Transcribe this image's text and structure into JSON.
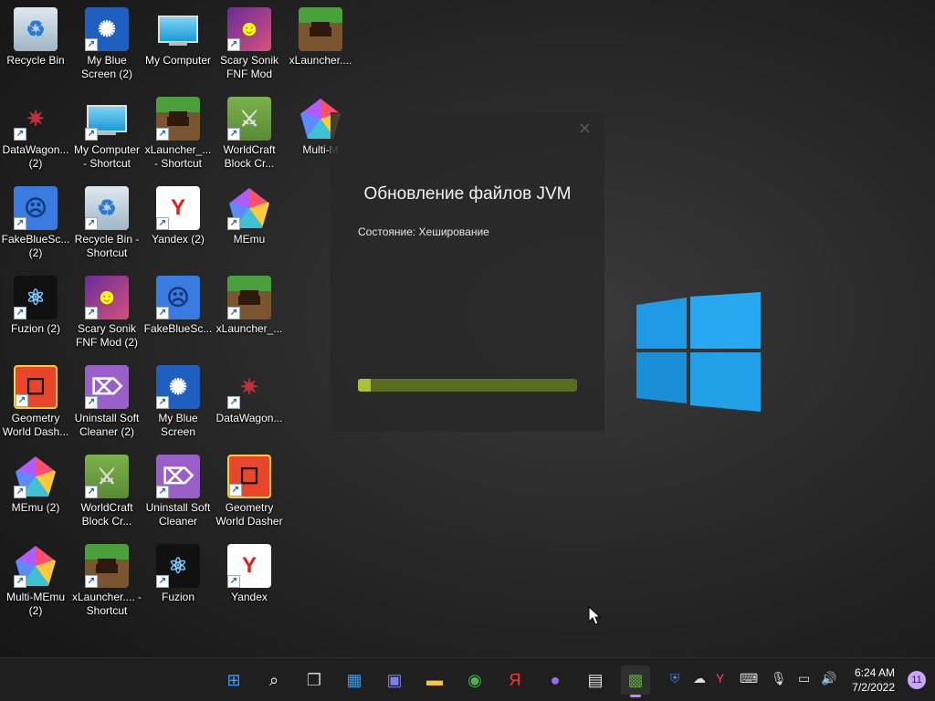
{
  "desktop": {
    "icons": [
      {
        "label": "Recycle Bin",
        "type": "bin",
        "shortcut": false
      },
      {
        "label": "DataWagon... (2)",
        "type": "dw",
        "shortcut": true
      },
      {
        "label": "FakeBlueSc... (2)",
        "type": "fake",
        "shortcut": true
      },
      {
        "label": "Fuzion (2)",
        "type": "fuz",
        "shortcut": true
      },
      {
        "label": "Geometry World Dash...",
        "type": "gd",
        "shortcut": true
      },
      {
        "label": "MEmu (2)",
        "type": "memu",
        "shortcut": true
      },
      {
        "label": "Multi-MEmu (2)",
        "type": "multi",
        "shortcut": true
      },
      {
        "label": "My Blue Screen (2)",
        "type": "blue",
        "shortcut": true
      },
      {
        "label": "My Computer - Shortcut",
        "type": "pc",
        "shortcut": true
      },
      {
        "label": "Recycle Bin - Shortcut",
        "type": "bin",
        "shortcut": true
      },
      {
        "label": "Scary Sonik FNF Mod (2)",
        "type": "sonic",
        "shortcut": true
      },
      {
        "label": "Uninstall Soft Cleaner (2)",
        "type": "uninst",
        "shortcut": true
      },
      {
        "label": "WorldCraft Block Cr...",
        "type": "wc",
        "shortcut": true
      },
      {
        "label": "xLauncher.... - Shortcut",
        "type": "mc",
        "shortcut": true
      },
      {
        "label": "My Computer",
        "type": "pc",
        "shortcut": false
      },
      {
        "label": "xLauncher_... - Shortcut",
        "type": "mc",
        "shortcut": true
      },
      {
        "label": "Yandex (2)",
        "type": "yandex",
        "shortcut": true
      },
      {
        "label": "FakeBlueSc...",
        "type": "fake",
        "shortcut": true
      },
      {
        "label": "My Blue Screen",
        "type": "blue",
        "shortcut": true
      },
      {
        "label": "Uninstall Soft Cleaner",
        "type": "uninst",
        "shortcut": true
      },
      {
        "label": "Fuzion",
        "type": "fuz",
        "shortcut": true
      },
      {
        "label": "Scary Sonik FNF Mod",
        "type": "sonic",
        "shortcut": true
      },
      {
        "label": "WorldCraft Block Cr...",
        "type": "wc",
        "shortcut": true
      },
      {
        "label": "MEmu",
        "type": "memu",
        "shortcut": true
      },
      {
        "label": "xLauncher_...",
        "type": "mc",
        "shortcut": true
      },
      {
        "label": "DataWagon...",
        "type": "dw",
        "shortcut": true
      },
      {
        "label": "Geometry World Dasher",
        "type": "gd",
        "shortcut": true
      },
      {
        "label": "Yandex",
        "type": "yandex",
        "shortcut": true
      },
      {
        "label": "xLauncher....",
        "type": "mc",
        "shortcut": false
      },
      {
        "label": "Multi-M",
        "type": "multi",
        "shortcut": false
      }
    ]
  },
  "dialog": {
    "title": "Обновление файлов JVM",
    "status": "Состояние: Хеширование",
    "progress": 0.06
  },
  "taskbar": {
    "items": [
      {
        "name": "start-button",
        "glyph": "⊞",
        "color": "#3aa0ff"
      },
      {
        "name": "search-button",
        "glyph": "⌕",
        "color": "#ffffff"
      },
      {
        "name": "task-view-button",
        "glyph": "❐",
        "color": "#cccccc"
      },
      {
        "name": "widgets-button",
        "glyph": "▦",
        "color": "#3a9ae8"
      },
      {
        "name": "teams-chat-button",
        "glyph": "▣",
        "color": "#7b83eb"
      },
      {
        "name": "file-explorer-button",
        "glyph": "▬",
        "color": "#f6c342"
      },
      {
        "name": "chrome-button",
        "glyph": "◉",
        "color": "#4caf50"
      },
      {
        "name": "yandex-browser-button",
        "glyph": "Я",
        "color": "#ff3333"
      },
      {
        "name": "alice-button",
        "glyph": "●",
        "color": "#9b6bff"
      },
      {
        "name": "store-button",
        "glyph": "▤",
        "color": "#e0e0e0"
      },
      {
        "name": "xlauncher-taskbar-button",
        "glyph": "▩",
        "color": "#5aa040"
      }
    ],
    "time": "6:24 AM",
    "date": "7/2/2022",
    "notifications": "11"
  }
}
